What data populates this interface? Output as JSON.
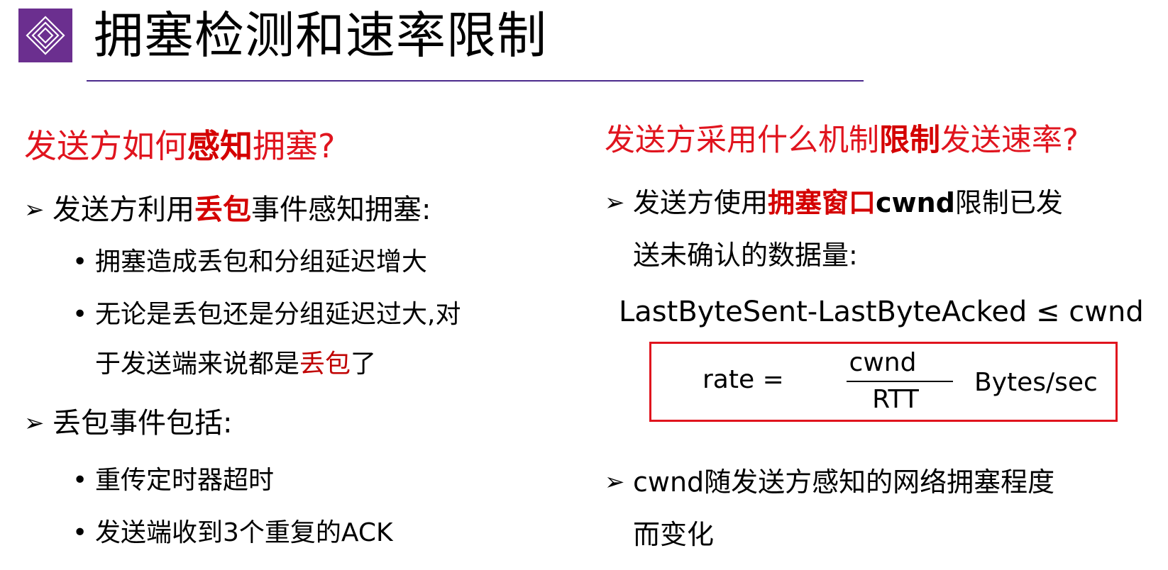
{
  "slide": {
    "title": "拥塞检测和速率限制",
    "left": {
      "question": {
        "pre": "发送方如何",
        "emph": "感知",
        "post": "拥塞?"
      },
      "point1": {
        "pre": "发送方利用",
        "emph": "丢包",
        "post": "事件感知拥塞:"
      },
      "point1_bullets": {
        "b1": "拥塞造成丢包和分组延迟增大",
        "b2_line1": "无论是丢包还是分组延迟过大,对",
        "b2_line2_pre": "于发送端来说都是",
        "b2_line2_emph": "丢包",
        "b2_line2_post": "了"
      },
      "point2": "丢包事件包括:",
      "point2_bullets": {
        "b1": "重传定时器超时",
        "b2": "发送端收到3个重复的ACK"
      }
    },
    "right": {
      "question": {
        "pre": "发送方采用什么机制",
        "emph": "限制",
        "post": "发送速率?"
      },
      "point1": {
        "pre": "发送方使用",
        "emph": "拥塞窗口",
        "bold": "cwnd",
        "post": "限制已发",
        "line2": "送未确认的数据量:"
      },
      "inequality": "LastByteSent-LastByteAcked ≤ cwnd",
      "formula": {
        "lhs": "rate =",
        "numerator": "cwnd",
        "denominator": "RTT",
        "unit": "Bytes/sec"
      },
      "point2": {
        "line1": "cwnd随发送方感知的网络拥塞程度",
        "line2": "而变化"
      }
    },
    "symbols": {
      "arrow": "➢",
      "bullet": "•"
    },
    "colors": {
      "accent_red": "#e0141e",
      "brand_purple": "#6b2f8f",
      "rule": "#4b2a8c"
    }
  }
}
